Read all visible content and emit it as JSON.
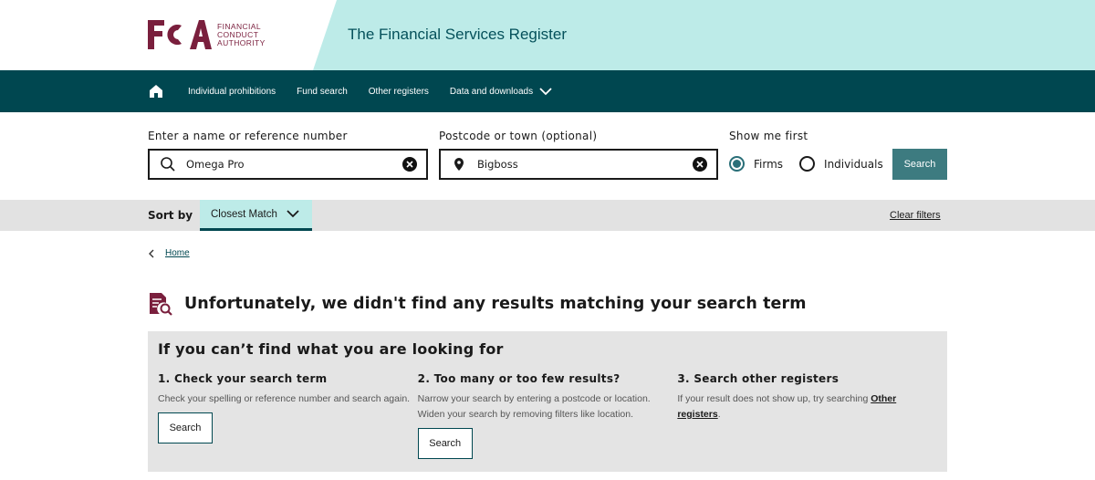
{
  "header": {
    "logo_letters": "FCA",
    "logo_text": [
      "FINANCIAL",
      "CONDUCT",
      "AUTHORITY"
    ],
    "title": "The Financial Services Register"
  },
  "nav": {
    "home_icon": "home-icon",
    "items": [
      "Individual prohibitions",
      "Fund search",
      "Other registers",
      "Data and downloads"
    ]
  },
  "search": {
    "name_label": "Enter a name or reference number",
    "name_value": "Omega Pro",
    "location_label": "Postcode or town (optional)",
    "location_value": "Bigboss",
    "show_first_label": "Show me first",
    "options": [
      "Firms",
      "Individuals"
    ],
    "selected_option": "Firms",
    "button_label": "Search"
  },
  "sort": {
    "label": "Sort by",
    "value": "Closest Match",
    "clear_filters": "Clear filters"
  },
  "breadcrumb": {
    "home": "Home"
  },
  "results": {
    "no_results_message": "Unfortunately, we didn't find any results matching your search term"
  },
  "help": {
    "title": "If you can’t find what you are looking for",
    "columns": [
      {
        "heading": "1. Check your search term",
        "text": "Check your spelling or reference number and search again.",
        "button": "Search"
      },
      {
        "heading": "2. Too many or too few results?",
        "text": "Narrow your search by entering a postcode or location. Widen your search by removing filters like location.",
        "button": "Search"
      },
      {
        "heading": "3. Search other registers",
        "text_prefix": "If your result does not show up, try searching ",
        "link": "Other registers",
        "text_suffix": "."
      }
    ]
  },
  "colors": {
    "brand_maroon": "#7a1f3d",
    "nav_teal": "#004750",
    "header_band": "#bdebe8",
    "search_button": "#3d7b80"
  }
}
